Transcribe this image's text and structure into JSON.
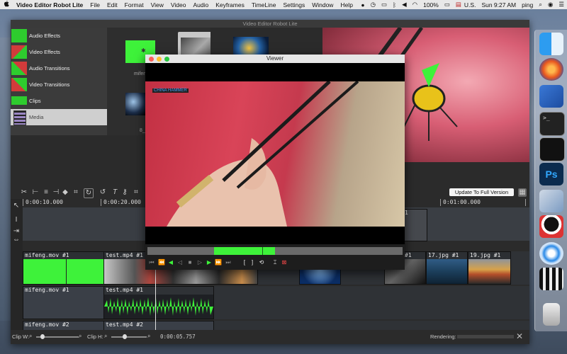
{
  "menubar": {
    "apple": "",
    "app_name": "Video Editor Robot Lite",
    "items": [
      "File",
      "Edit",
      "Format",
      "View",
      "Video",
      "Audio",
      "Keyframes",
      "TimeLine",
      "Settings",
      "Window",
      "Help"
    ],
    "battery": "100%",
    "locale": "U.S.",
    "clock": "Sun 9:27 AM",
    "user": "ping"
  },
  "window": {
    "title": "Video Editor Robot Lite"
  },
  "sidebar": {
    "items": [
      {
        "label": "Audio Effects",
        "color": "#2ecc2e"
      },
      {
        "label": "Video Effects",
        "color": "#d23b3b"
      },
      {
        "label": "Audio Transitions",
        "color": "#d23b3b"
      },
      {
        "label": "Video Transitions",
        "color": "#2ecc2e"
      },
      {
        "label": "Clips",
        "color": "#2ecc2e"
      },
      {
        "label": "Media",
        "color": "#8a6fb0",
        "selected": true
      }
    ]
  },
  "media": {
    "labels": [
      "mifen",
      "8_"
    ]
  },
  "toolbar": {
    "update_label": "Update To Full Version"
  },
  "ruler": {
    "ticks": [
      "0:00:10.000",
      "0:00:20.000",
      "0:01:00.000"
    ]
  },
  "tracks": {
    "video1": [
      {
        "label": "mifeng.mov #1"
      },
      {
        "label": "test.mp4 #1"
      },
      {
        "label": "#1"
      },
      {
        "label": "17.jpg #1"
      },
      {
        "label": "19.jpg #1"
      }
    ],
    "audio1": [
      {
        "label": "mifeng.mov #1"
      },
      {
        "label": "test.mp4 #1"
      }
    ],
    "row3": [
      {
        "label": "mifeng.mov #2"
      },
      {
        "label": "test.mp4 #2"
      }
    ],
    "top_partial": "1"
  },
  "status": {
    "clip_w": "Clip W:",
    "clip_h": "Clip H:",
    "timecode": "0:00:05.757",
    "rendering": "Rendering:"
  },
  "viewer": {
    "title": "Viewer",
    "watermark": "CHINA HAMMER",
    "scrub_start": 0.26,
    "scrub_end": 0.5,
    "scrub_marker": 0.45
  },
  "colors": {
    "green": "#3ef23a",
    "menubar": "#e8e8e8"
  }
}
